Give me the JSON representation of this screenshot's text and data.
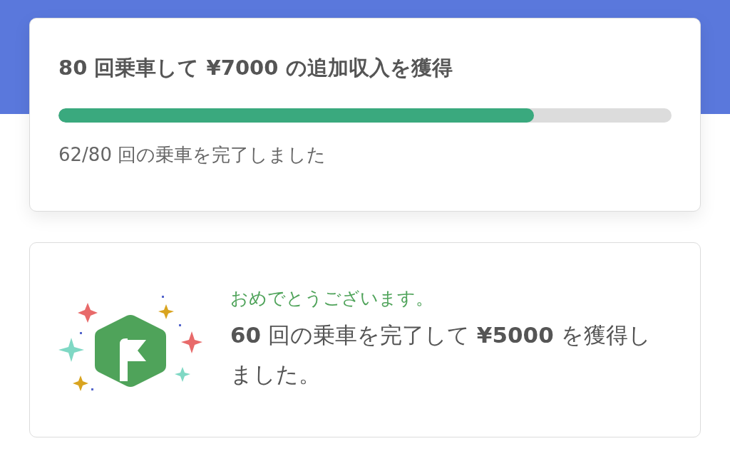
{
  "goal_card": {
    "title": "**80** 回乗車して **¥7000** の追加収入を獲得",
    "progress": {
      "level": 0.775
    },
    "status": "62/80 回の乗車を完了しました"
  },
  "achievement_card": {
    "greeting": "おめでとうございます。",
    "message": "**60** 回の乗車を完了して **¥5000** を獲得しました。"
  }
}
